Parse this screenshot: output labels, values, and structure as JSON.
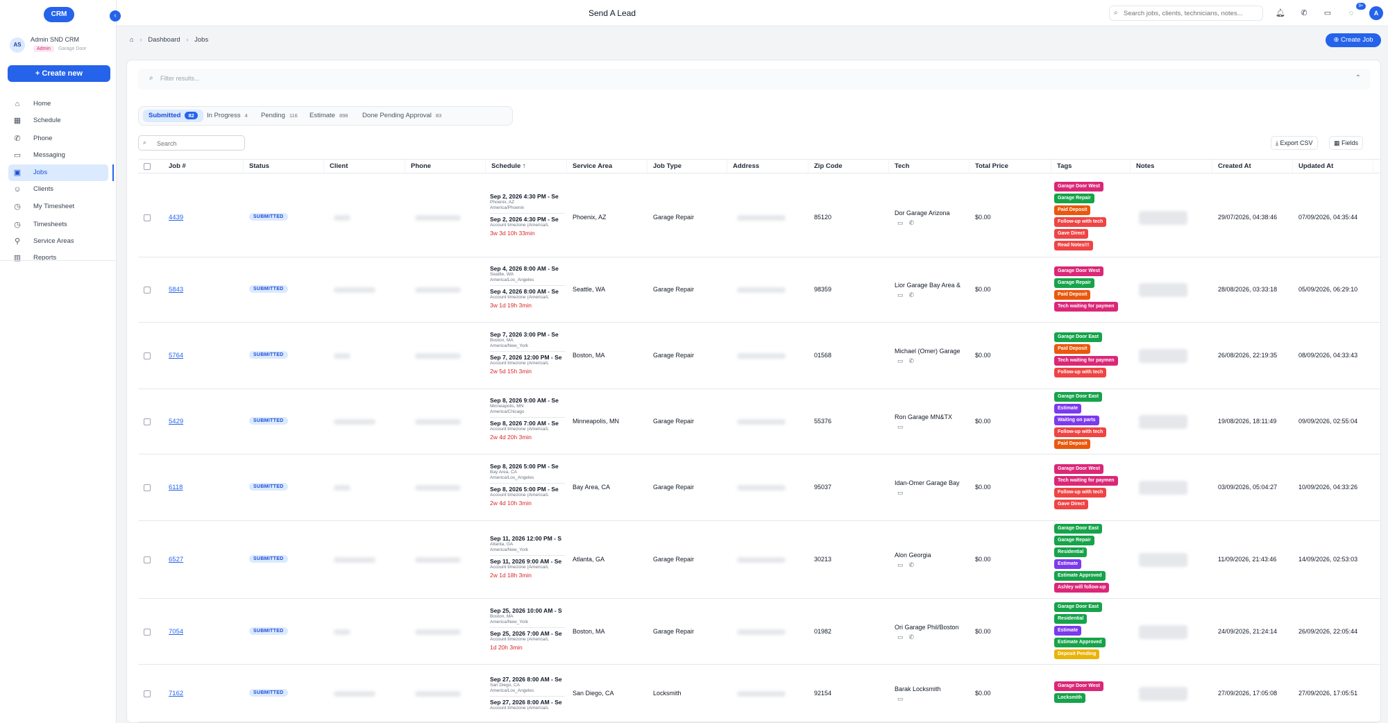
{
  "app": {
    "logo": "CRM",
    "title": "Send A Lead",
    "collapse_icon": "‹"
  },
  "user": {
    "initials": "AS",
    "name": "Admin SND CRM",
    "role": "Admin",
    "company": "Garage Door"
  },
  "sidebar": {
    "create_new": "+ Create new",
    "items": [
      {
        "label": "Home",
        "icon": "home-icon",
        "glyph": "⌂"
      },
      {
        "label": "Schedule",
        "icon": "calendar-icon",
        "glyph": "▦"
      },
      {
        "label": "Phone",
        "icon": "phone-icon",
        "glyph": "✆"
      },
      {
        "label": "Messaging",
        "icon": "message-icon",
        "glyph": "▭"
      },
      {
        "label": "Jobs",
        "icon": "briefcase-icon",
        "glyph": "▣"
      },
      {
        "label": "Clients",
        "icon": "users-icon",
        "glyph": "☺"
      },
      {
        "label": "My Timesheet",
        "icon": "clock-icon",
        "glyph": "◷"
      },
      {
        "label": "Timesheets",
        "icon": "clock-icon",
        "glyph": "◷"
      },
      {
        "label": "Service Areas",
        "icon": "map-pin-icon",
        "glyph": "⚲"
      },
      {
        "label": "Reports",
        "icon": "chart-icon",
        "glyph": "▥"
      }
    ]
  },
  "topbar": {
    "search_placeholder": "Search jobs, clients, technicians, notes...",
    "notif_count": "9+",
    "avatar": "A"
  },
  "breadcrumb": {
    "root": "Dashboard",
    "current": "Jobs"
  },
  "create_job": "⊕ Create Job",
  "filter": {
    "placeholder": "Filter results..."
  },
  "tabs": [
    {
      "label": "Submitted",
      "count": "82"
    },
    {
      "label": "In Progress",
      "count": "4"
    },
    {
      "label": "Pending",
      "count": "116"
    },
    {
      "label": "Estimate",
      "count": "898"
    },
    {
      "label": "Done Pending Approval",
      "count": "83"
    }
  ],
  "table": {
    "search_placeholder": "Search",
    "export_label": "⤓ Export CSV",
    "fields_label": "▦ Fields",
    "columns": [
      "Job #",
      "Status",
      "Client",
      "Phone",
      "Schedule ↑",
      "Service Area",
      "Job Type",
      "Address",
      "Zip Code",
      "Tech",
      "Total Price",
      "Tags",
      "Notes",
      "Created At",
      "Updated At"
    ],
    "rows": [
      {
        "job": "4439",
        "status": "SUBMITTED",
        "s1": "Sep 2, 2026 4:30 PM - Se",
        "s1a": "Phoenix, AZ",
        "s1b": "America/Phoenix",
        "s2": "Sep 2, 2026 4:30 PM - Se",
        "s2a": "Account timezone (America/L",
        "s3": "3w 3d 10h 33min",
        "area": "Phoenix, AZ",
        "type": "Garage Repair",
        "zip": "85120",
        "tech": "Dor Garage Arizona",
        "phone_icon": true,
        "price": "$0.00",
        "tags": [
          "Garage Door West",
          "Garage Repair",
          "Paid Deposit",
          "Follow-up with tech",
          "Gave Direct",
          "Read Notes!!!"
        ],
        "created": "29/07/2026, 04:38:46",
        "updated": "07/09/2026, 04:35:44"
      },
      {
        "job": "5843",
        "status": "SUBMITTED",
        "s1": "Sep 4, 2026 8:00 AM - Se",
        "s1a": "Seattle, WA",
        "s1b": "America/Los_Angeles",
        "s2": "Sep 4, 2026 8:00 AM - Se",
        "s2a": "Account timezone (America/L",
        "s3": "3w 1d 19h 3min",
        "area": "Seattle, WA",
        "type": "Garage Repair",
        "zip": "98359",
        "tech": "Lior Garage Bay Area &",
        "phone_icon": true,
        "price": "$0.00",
        "tags": [
          "Garage Door West",
          "Garage Repair",
          "Paid Deposit",
          "Tech waiting for paymen"
        ],
        "created": "28/08/2026, 03:33:18",
        "updated": "05/09/2026, 06:29:10"
      },
      {
        "job": "5764",
        "status": "SUBMITTED",
        "s1": "Sep 7, 2026 3:00 PM - Se",
        "s1a": "Boston, MA",
        "s1b": "America/New_York",
        "s2": "Sep 7, 2026 12:00 PM - Se",
        "s2a": "Account timezone (America/L",
        "s3": "2w 5d 15h 3min",
        "area": "Boston, MA",
        "type": "Garage Repair",
        "zip": "01568",
        "tech": "Michael (Omer) Garage",
        "phone_icon": true,
        "price": "$0.00",
        "tags": [
          "Garage Door East",
          "Paid Deposit",
          "Tech waiting for paymen",
          "Follow-up with tech"
        ],
        "created": "26/08/2026, 22:19:35",
        "updated": "08/09/2026, 04:33:43"
      },
      {
        "job": "5429",
        "status": "SUBMITTED",
        "s1": "Sep 8, 2026 9:00 AM - Se",
        "s1a": "Minneapolis, MN",
        "s1b": "America/Chicago",
        "s2": "Sep 8, 2026 7:00 AM - Se",
        "s2a": "Account timezone (America/L",
        "s3": "2w 4d 20h 3min",
        "area": "Minneapolis, MN",
        "type": "Garage Repair",
        "zip": "55376",
        "tech": "Ron Garage MN&TX",
        "phone_icon": false,
        "price": "$0.00",
        "tags": [
          "Garage Door East",
          "Estimate",
          "Waiting on parts",
          "Follow-up with tech",
          "Paid Deposit"
        ],
        "created": "19/08/2026, 18:11:49",
        "updated": "09/09/2026, 02:55:04"
      },
      {
        "job": "6118",
        "status": "SUBMITTED",
        "s1": "Sep 8, 2026 5:00 PM - Se",
        "s1a": "Bay Area, CA",
        "s1b": "America/Los_Angeles",
        "s2": "Sep 8, 2026 5:00 PM - Se",
        "s2a": "Account timezone (America/L",
        "s3": "2w 4d 10h 3min",
        "area": "Bay Area, CA",
        "type": "Garage Repair",
        "zip": "95037",
        "tech": "Idan-Omer Garage Bay",
        "phone_icon": false,
        "price": "$0.00",
        "tags": [
          "Garage Door West",
          "Tech waiting for paymen",
          "Follow-up with tech",
          "Gave Direct"
        ],
        "created": "03/09/2026, 05:04:27",
        "updated": "10/09/2026, 04:33:26"
      },
      {
        "job": "6527",
        "status": "SUBMITTED",
        "s1": "Sep 11, 2026 12:00 PM - S",
        "s1a": "Atlanta, GA",
        "s1b": "America/New_York",
        "s2": "Sep 11, 2026 9:00 AM - Se",
        "s2a": "Account timezone (America/L",
        "s3": "2w 1d 18h 3min",
        "area": "Atlanta, GA",
        "type": "Garage Repair",
        "zip": "30213",
        "tech": "Alon Georgia",
        "phone_icon": true,
        "price": "$0.00",
        "tags": [
          "Garage Door East",
          "Garage Repair",
          "Residential",
          "Estimate",
          "Estimate Approved",
          "Ashley will follow-up"
        ],
        "created": "11/09/2026, 21:43:46",
        "updated": "14/09/2026, 02:53:03"
      },
      {
        "job": "7054",
        "status": "SUBMITTED",
        "s1": "Sep 25, 2026 10:00 AM - S",
        "s1a": "Boston, MA",
        "s1b": "America/New_York",
        "s2": "Sep 25, 2026 7:00 AM - Se",
        "s2a": "Account timezone (America/L",
        "s3": "1d 20h 3min",
        "area": "Boston, MA",
        "type": "Garage Repair",
        "zip": "01982",
        "tech": "Ori Garage Phil/Boston",
        "phone_icon": true,
        "price": "$0.00",
        "tags": [
          "Garage Door East",
          "Residential",
          "Estimate",
          "Estimate Approved",
          "Deposit Pending"
        ],
        "created": "24/09/2026, 21:24:14",
        "updated": "26/09/2026, 22:05:44"
      },
      {
        "job": "7162",
        "status": "SUBMITTED",
        "s1": "Sep 27, 2026 8:00 AM - Se",
        "s1a": "San Diego, CA",
        "s1b": "America/Los_Angeles",
        "s2": "Sep 27, 2026 8:00 AM - Se",
        "s2a": "Account timezone (America/L",
        "s3": "",
        "area": "San Diego, CA",
        "type": "Locksmith",
        "zip": "92154",
        "tech": "Barak Locksmith",
        "phone_icon": false,
        "price": "$0.00",
        "tags": [
          "Garage Door West",
          "Locksmith"
        ],
        "created": "27/09/2026, 17:05:08",
        "updated": "27/09/2026, 17:05:51"
      }
    ]
  },
  "tag_colors": {
    "Garage Door West": "#db2777",
    "Garage Door East": "#16a34a",
    "Garage Repair": "#16a34a",
    "Paid Deposit": "#ea580c",
    "Follow-up with tech": "#ef4444",
    "Gave Direct": "#ef4444",
    "Read Notes!!!": "#ef4444",
    "Tech waiting for paymen": "#db2777",
    "Estimate": "#7c3aed",
    "Waiting on parts": "#7c3aed",
    "Residential": "#16a34a",
    "Estimate Approved": "#16a34a",
    "Ashley will follow-up": "#db2777",
    "Deposit Pending": "#eab308",
    "Locksmith": "#16a34a"
  }
}
